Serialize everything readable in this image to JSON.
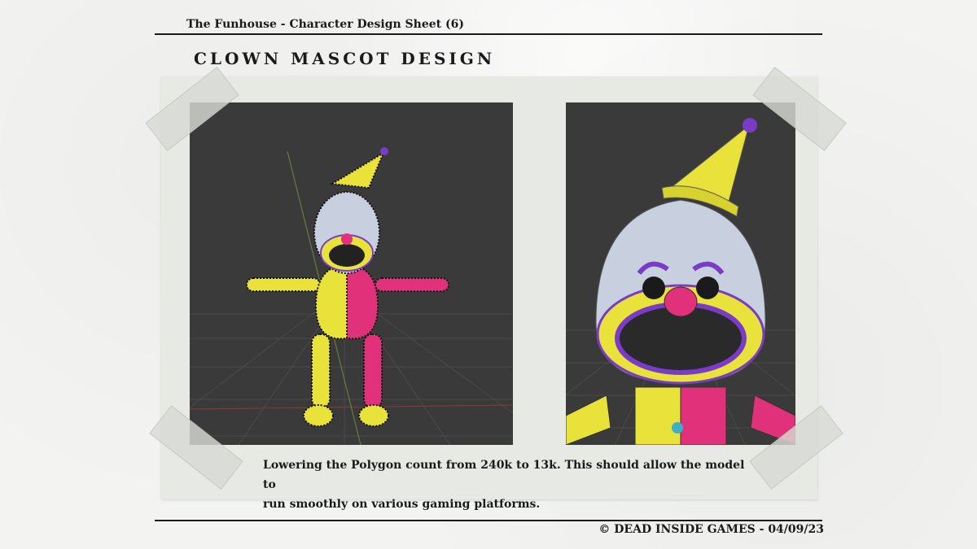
{
  "header": {
    "title": "The Funhouse - Character Design Sheet (6)",
    "design_title": "CLOWN MASCOT DESIGN"
  },
  "images": {
    "left_alt": "Full-body wireframe render of clown mascot in T-pose",
    "right_alt": "Close-up wireframe render of clown mascot face"
  },
  "caption": {
    "line1": "Lowering the Polygon count from 240k to 13k. This should allow the model to",
    "line2": "run smoothly on various gaming platforms."
  },
  "footer": {
    "copyright": "© DEAD INSIDE GAMES - 04/09/23"
  },
  "colors": {
    "background": "#f3f3f2",
    "board": "#e6e9e4",
    "viewport": "#3a3a3a",
    "clown_yellow": "#e8e23a",
    "clown_pink": "#e0317a",
    "clown_white": "#c8d0e0",
    "clown_purple": "#7a3cc8"
  }
}
